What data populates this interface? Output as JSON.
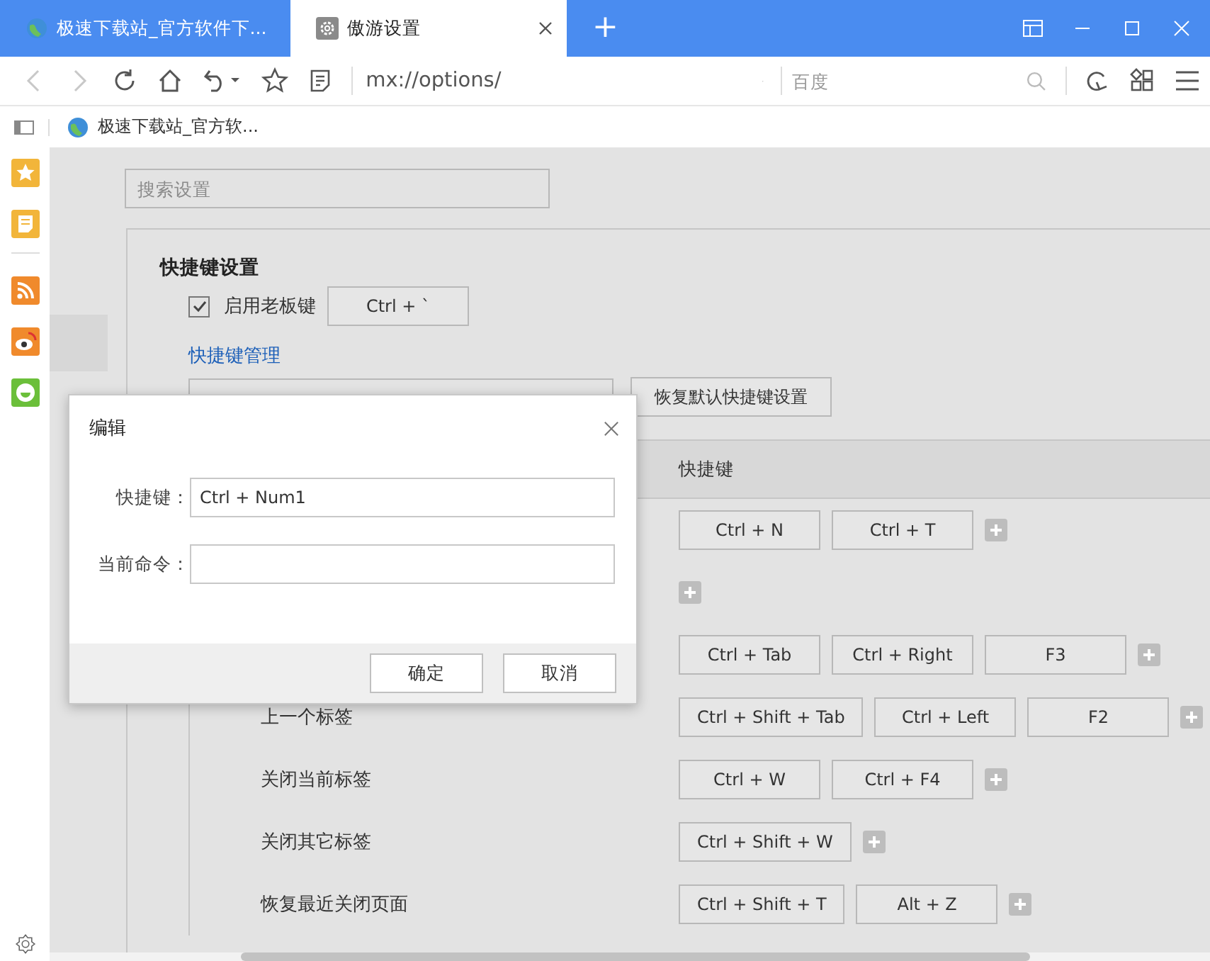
{
  "tabs": [
    {
      "title": "极速下载站_官方软件下...",
      "kind": "web",
      "selected": false
    },
    {
      "title": "傲游设置",
      "kind": "settings",
      "selected": true
    }
  ],
  "new_tab": "+",
  "toolbar": {
    "address": "mx://options/",
    "search_placeholder": "百度",
    "back_disabled": true,
    "forward_disabled": true
  },
  "bookmarks": [
    {
      "label": "极速下载站_官方软..."
    }
  ],
  "settings": {
    "search_placeholder": "搜索设置",
    "section_title": "快捷键设置",
    "boss_key": {
      "label": "启用老板键",
      "checked": true,
      "key": "Ctrl + `"
    },
    "manage_link": "快捷键管理",
    "restore_button": "恢复默认快捷键设置",
    "table": {
      "columns": [
        "快捷键"
      ],
      "rows": [
        {
          "keys": [
            "Ctrl + N",
            "Ctrl + T"
          ]
        },
        {
          "add": true
        },
        {
          "keys": [
            "Ctrl + Tab",
            "Ctrl + Right",
            "F3"
          ]
        },
        {
          "command": "上一个标签",
          "keys": [
            "Ctrl + Shift + Tab",
            "Ctrl + Left",
            "F2"
          ]
        },
        {
          "command": "关闭当前标签",
          "keys": [
            "Ctrl + W",
            "Ctrl + F4"
          ]
        },
        {
          "command": "关闭其它标签",
          "keys": [
            "Ctrl + Shift + W"
          ]
        },
        {
          "command": "恢复最近关闭页面",
          "keys": [
            "Ctrl + Shift + T",
            "Alt + Z"
          ]
        }
      ]
    }
  },
  "dialog": {
    "title": "编辑",
    "fields": [
      {
        "label": "快捷键：",
        "value": "Ctrl + Num1"
      },
      {
        "label": "当前命令："
      }
    ],
    "buttons": [
      "确定",
      "取消"
    ]
  }
}
